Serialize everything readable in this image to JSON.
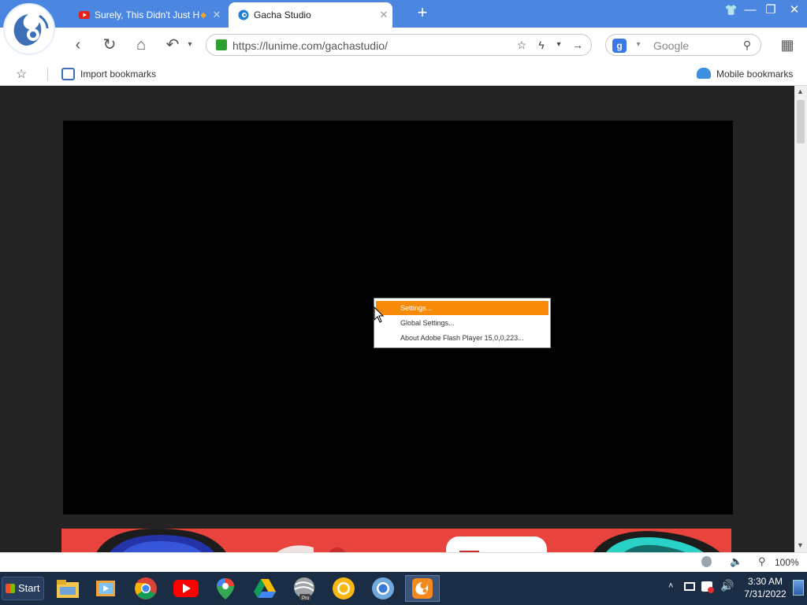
{
  "browser": {
    "tabs": [
      {
        "title": "Surely, This Didn't Just H",
        "active": false,
        "favicon": "youtube-icon"
      },
      {
        "title": "Gacha Studio",
        "active": true,
        "favicon": "gacha-icon"
      }
    ],
    "url": "https://lunime.com/gachastudio/",
    "search_placeholder": "Google",
    "bookmarks": {
      "import": "Import bookmarks",
      "mobile": "Mobile bookmarks"
    },
    "zoom": "100%"
  },
  "context_menu": {
    "items": [
      {
        "label": "Settings...",
        "selected": true
      },
      {
        "label": "Global Settings...",
        "selected": false
      },
      {
        "label": "About Adobe Flash Player 15,0,0,223..."
      }
    ]
  },
  "taskbar": {
    "start_label": "Start",
    "time": "3:30 AM",
    "date": "7/31/2022",
    "apps": [
      "file-explorer",
      "media-player",
      "chrome",
      "youtube",
      "google-maps",
      "google-drive",
      "chrome-pro",
      "chrome-canary",
      "chromium",
      "uc-browser"
    ]
  },
  "colors": {
    "titlebar": "#4b86e0",
    "menu_highlight": "#f98a09",
    "taskbar": "#1b2c45"
  }
}
